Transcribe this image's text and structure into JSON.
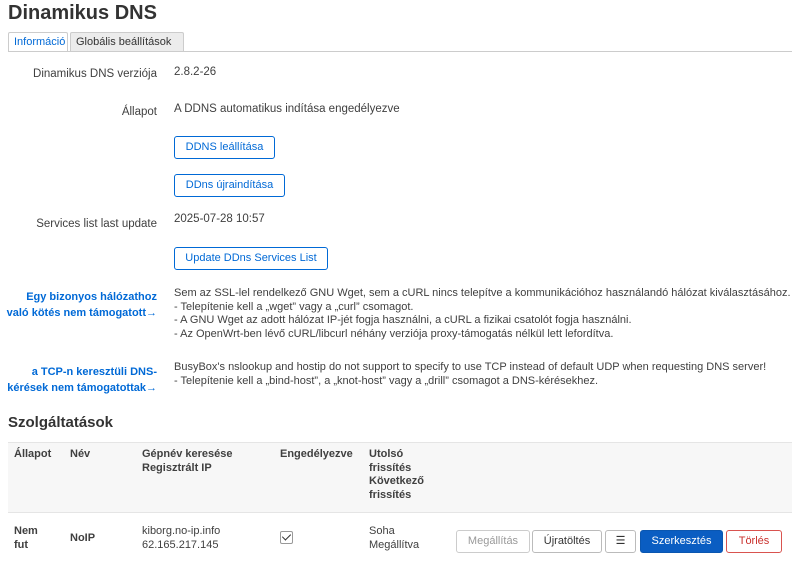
{
  "page_title": "Dinamikus DNS",
  "tabs": [
    {
      "label": "Információ",
      "active": true
    },
    {
      "label": "Globális beállítások",
      "active": false
    }
  ],
  "info": {
    "version_label": "Dinamikus DNS verziója",
    "version_value": "2.8.2-26",
    "status_label": "Állapot",
    "status_value": "A DDNS automatikus indítása engedélyezve",
    "stop_button": "DDNS leállítása",
    "restart_button": "DDns újraindítása",
    "services_label": "Services list last update",
    "services_value": "2025-07-28 10:57",
    "update_button": "Update DDns Services List"
  },
  "warnings": [
    {
      "link_line1": "Egy bizonyos hálózathoz",
      "link_line2": "való kötés nem támogatott→",
      "lines": [
        "Sem az SSL-lel rendelkező GNU Wget, sem a cURL nincs telepítve a kommunikációhoz használandó hálózat kiválasztásához.",
        "- Telepítenie kell a „wget” vagy a „curl” csomagot.",
        "- A GNU Wget az adott hálózat IP-jét fogja használni, a cURL a fizikai csatolót fogja használni.",
        "- Az OpenWrt-ben lévő cURL/libcurl néhány verziója proxy-támogatás nélkül lett lefordítva."
      ]
    },
    {
      "link_line1": "a TCP-n keresztüli DNS-",
      "link_line2": "kérések nem támogatottak→",
      "lines": [
        "BusyBox's nslookup and hostip do not support to specify to use TCP instead of default UDP when requesting DNS server!",
        "- Telepítenie kell a „bind-host”, a „knot-host” vagy a „drill” csomagot a DNS-kérésekhez."
      ]
    }
  ],
  "services": {
    "title": "Szolgáltatások",
    "headers": {
      "status": "Állapot",
      "name": "Név",
      "lookup_line1": "Gépnév keresése",
      "lookup_line2": "Regisztrált IP",
      "enabled": "Engedélyezve",
      "update_line1": "Utolsó",
      "update_line2": "frissítés",
      "update_line3": "Következő",
      "update_line4": "frissítés"
    },
    "rows": [
      {
        "status_line1": "Nem",
        "status_line2": "fut",
        "name": "NoIP",
        "hostname": "kiborg.no-ip.info",
        "ip": "62.165.217.145",
        "enabled": true,
        "last_update": "Soha",
        "next_update": "Megállítva",
        "btn_stop": "Megállítás",
        "btn_reload": "Újratöltés",
        "btn_menu": "☰",
        "btn_edit": "Szerkesztés",
        "btn_delete": "Törlés"
      }
    ]
  }
}
